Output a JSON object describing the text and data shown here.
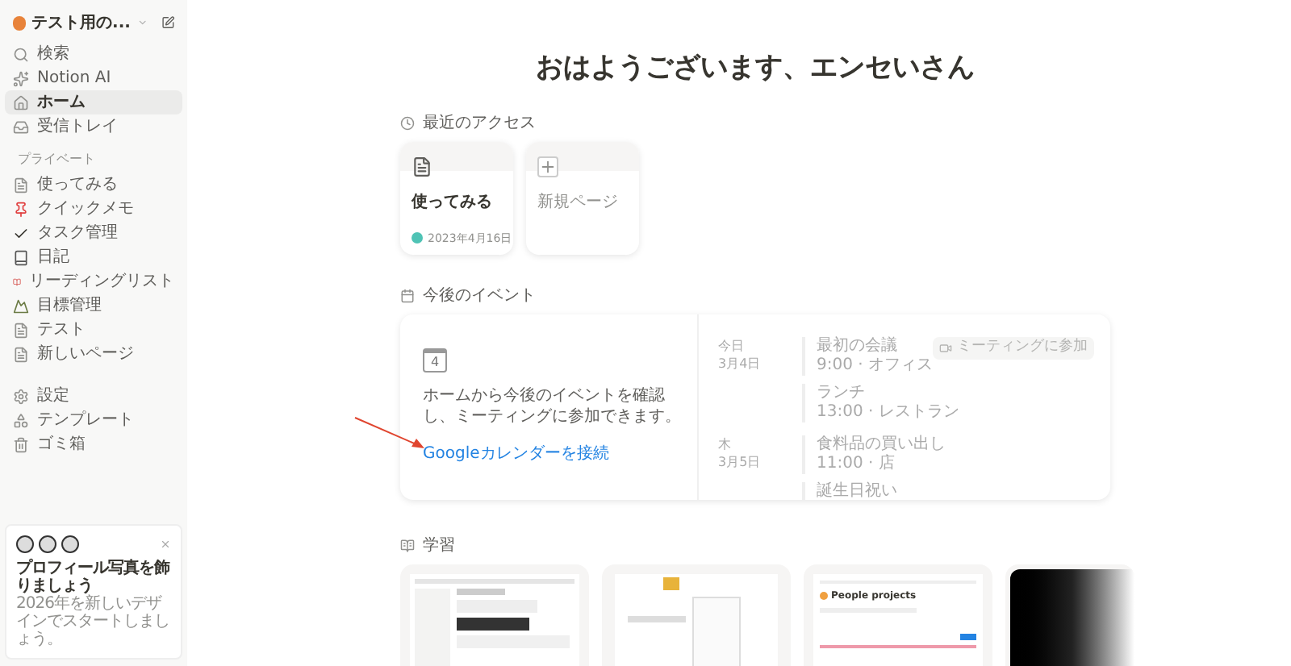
{
  "sidebar": {
    "workspace": "テスト用の...",
    "top_items": [
      {
        "label": "検索",
        "selected": false
      },
      {
        "label": "Notion AI",
        "selected": false
      },
      {
        "label": "ホーム",
        "selected": true
      },
      {
        "label": "受信トレイ",
        "selected": false
      }
    ],
    "section_label": "プライベート",
    "pages": [
      "使ってみる",
      "クイックメモ",
      "タスク管理",
      "日記",
      "リーディングリスト",
      "目標管理",
      "テスト",
      "新しいページ"
    ],
    "bottom_items": [
      "設定",
      "テンプレート",
      "ゴミ箱"
    ],
    "promo": {
      "title": "プロフィール写真を飾りましょう",
      "text": "2026年を新しいデザインでスタートしましょう。"
    }
  },
  "greeting": "おはようございます、エンセいさん",
  "recent": {
    "label": "最近のアクセス",
    "cards": [
      {
        "kind": "page",
        "title": "使ってみる",
        "date": "2023年4月16日"
      },
      {
        "kind": "new",
        "title": "新規ページ"
      }
    ]
  },
  "events": {
    "label": "今後のイベント",
    "calendar_day": "4",
    "message": "ホームから今後のイベントを確認し、ミーティングに参加できます。",
    "link": "Googleカレンダーを接続",
    "days": [
      {
        "day": "今日",
        "date": "3月4日",
        "items": [
          {
            "title": "最初の会議",
            "detail": "9:00 · オフィス",
            "action": "ミーティングに参加"
          },
          {
            "title": "ランチ",
            "detail": "13:00 · レストラン"
          }
        ]
      },
      {
        "day": "木",
        "date": "3月5日",
        "items": [
          {
            "title": "食料品の買い出し",
            "detail": "11:00 · 店"
          },
          {
            "title": "誕生日祝い"
          }
        ]
      }
    ]
  },
  "learning": {
    "label": "学習",
    "cards": [
      {
        "kind": "docs"
      },
      {
        "kind": "menu"
      },
      {
        "kind": "project",
        "title": "People projects"
      },
      {
        "kind": "dark"
      }
    ]
  }
}
